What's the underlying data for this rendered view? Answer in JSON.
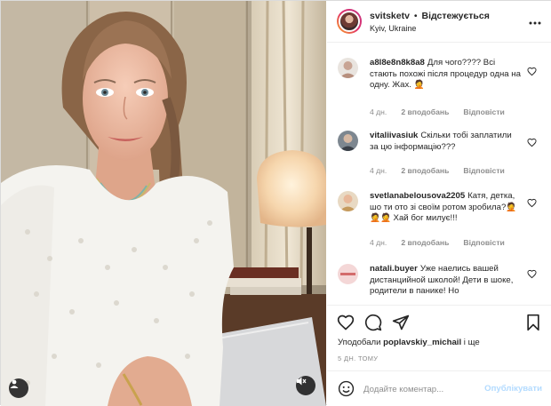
{
  "header": {
    "username": "svitsketv",
    "separator": "•",
    "follow_label": "Відстежується",
    "location": "Kyiv, Ukraine",
    "more_icon": "more-dots-icon"
  },
  "comments": [
    {
      "username": "a8l8e8n8k8a8",
      "text": "Для чого???? Всі стають похожі після процедур одна на одну. Жах. 🤦",
      "time": "4 дн.",
      "likes": "2 вподобань",
      "reply": "Відповісти"
    },
    {
      "username": "vitaliivasiuk",
      "text": "Скільки тобі заплатили за цю інформацію???",
      "time": "4 дн.",
      "likes": "2 вподобань",
      "reply": "Відповісти"
    },
    {
      "username": "svetlanabelousova2205",
      "text": "Катя, детка, шо ти ото зі своїм ротом зробила?🤦🤦🤦 Хай бог милує!!!",
      "time": "4 дн.",
      "likes": "2 вподобань",
      "reply": "Відповісти"
    },
    {
      "username": "natali.buyer",
      "text": "Уже наелись вашей дистанцийной школой! Дети в шоке, родители в панике! Но",
      "time": "",
      "likes": "",
      "reply": ""
    }
  ],
  "actions": {
    "like_icon": "heart-icon",
    "comment_icon": "comment-icon",
    "share_icon": "share-icon",
    "save_icon": "bookmark-icon"
  },
  "likes_summary": {
    "prefix": "Уподобали ",
    "user": "poplavskiy_michail",
    "suffix": " і ще"
  },
  "posted_ago": "5 ДН. ТОМУ",
  "add_comment": {
    "placeholder": "Додайте коментар...",
    "post_label": "Опублікувати",
    "emoji_icon": "emoji-icon"
  },
  "media": {
    "user_tag_icon": "user-tag-icon",
    "mute_icon": "speaker-muted-icon"
  },
  "colors": {
    "accent_blue": "#0095f6",
    "post_disabled": "#b3dbff",
    "muted_text": "#8e8e8e",
    "border": "#dbdbdb"
  }
}
